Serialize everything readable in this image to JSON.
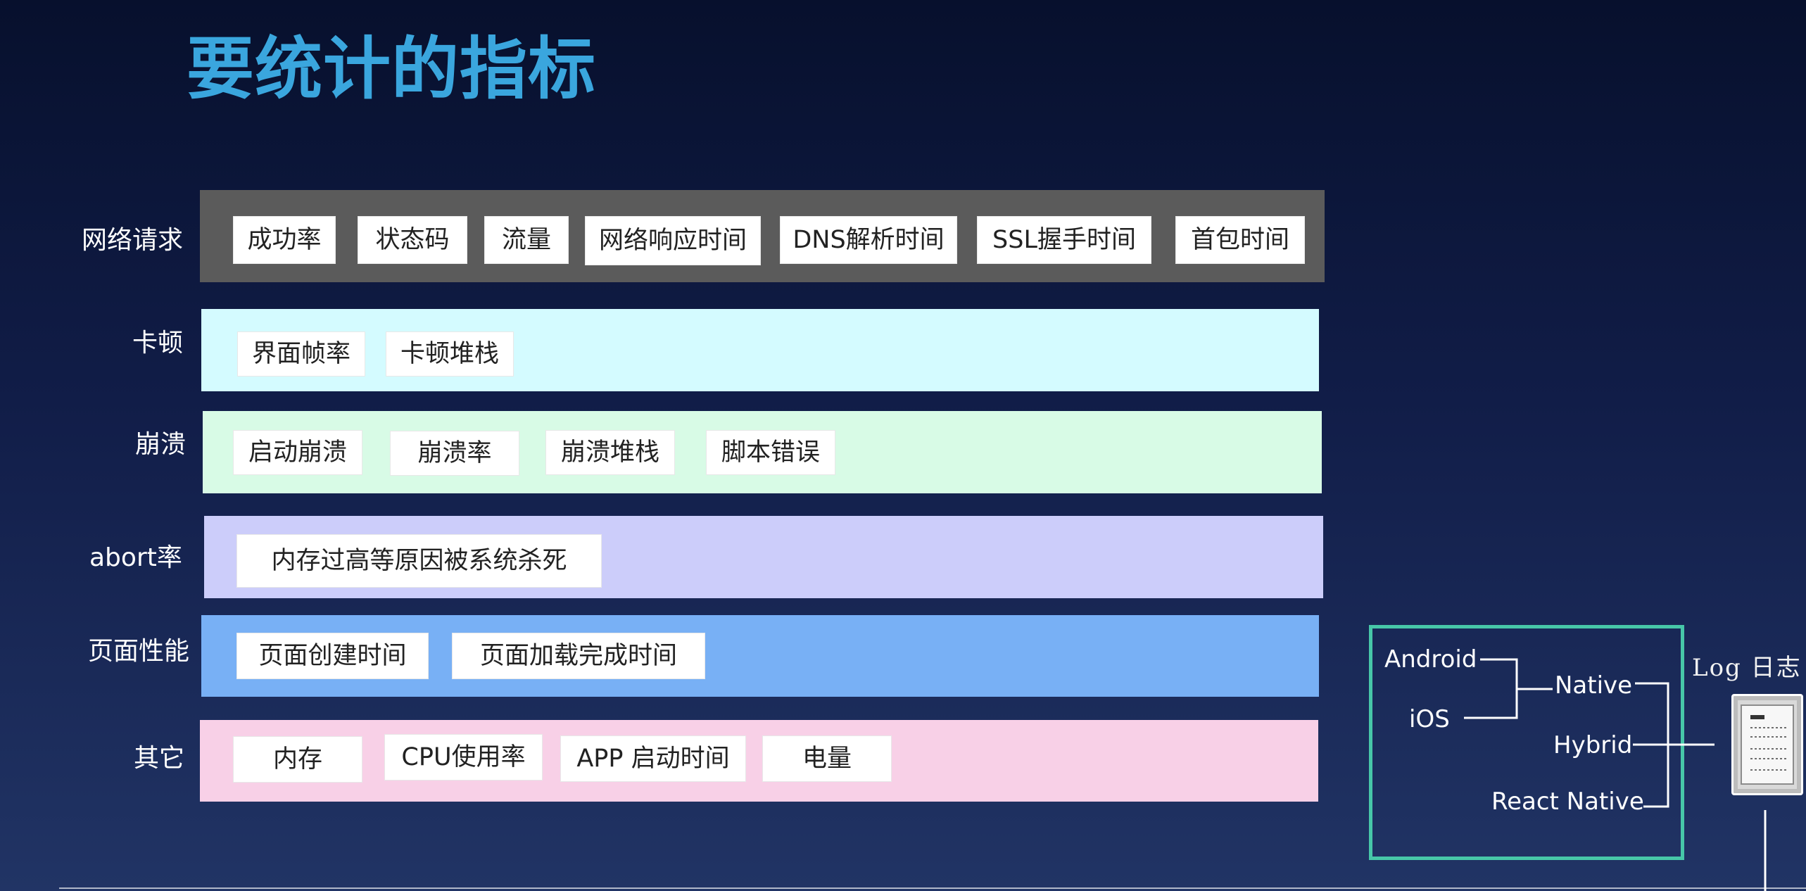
{
  "title": "要统计的指标",
  "categories": [
    {
      "label": "网络请求",
      "items": [
        "成功率",
        "状态码",
        "流量",
        "网络响应时间",
        "DNS解析时间",
        "SSL握手时间",
        "首包时间"
      ]
    },
    {
      "label": "卡顿",
      "items": [
        "界面帧率",
        "卡顿堆栈"
      ]
    },
    {
      "label": "崩溃",
      "items": [
        "启动崩溃",
        "崩溃率",
        "崩溃堆栈",
        "脚本错误"
      ]
    },
    {
      "label": "abort率",
      "items": [
        "内存过高等原因被系统杀死"
      ]
    },
    {
      "label": "页面性能",
      "items": [
        "页面创建时间",
        "页面加载完成时间"
      ]
    },
    {
      "label": "其它",
      "items": [
        "内存",
        "CPU使用率",
        "APP 启动时间",
        "电量"
      ]
    }
  ],
  "platforms": {
    "left": [
      "Android",
      "iOS"
    ],
    "right": [
      "Native",
      "Hybrid",
      "React Native"
    ]
  },
  "log_label": "Log 日志",
  "colors": {
    "title": "#3aa6de",
    "network_bar": "#5b5b5b",
    "jank_bar": "#d4fbff",
    "crash_bar": "#d8fbe6",
    "abort_bar": "#cccdfa",
    "page_perf_bar": "#78b0f5",
    "other_bar": "#f8d0e7",
    "platform_border": "#47c7a8"
  },
  "icons": {
    "server": "server-icon"
  }
}
